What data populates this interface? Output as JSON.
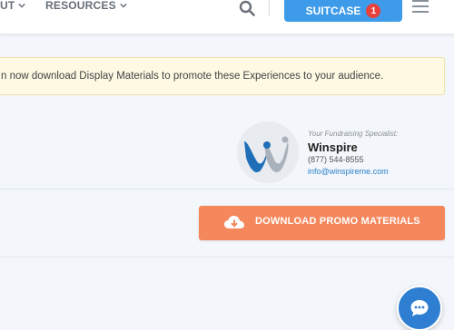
{
  "nav": {
    "items": [
      {
        "label": "UT"
      },
      {
        "label": "RESOURCES"
      }
    ],
    "suitcase_label": "SUITCASE",
    "suitcase_count": "1",
    "icons": {
      "search": "search-icon",
      "menu": "hamburger-menu-icon",
      "chevron": "chevron-down-icon"
    }
  },
  "notice": {
    "text": "n now download Display Materials to promote these Experiences to your audience."
  },
  "specialist": {
    "caption": "Your Fundraising Specialist:",
    "name": "Winspire",
    "phone": "(877) 544-8555",
    "email": "info@winspireme.com"
  },
  "download": {
    "label": "DOWNLOAD PROMO MATERIALS",
    "icon": "cloud-download-icon"
  },
  "chat": {
    "icon": "chat-bubble-icon"
  },
  "colors": {
    "accent_blue": "#3d9be9",
    "badge_red": "#e8413b",
    "download_orange": "#f5875c",
    "notice_bg": "#fdf9e3",
    "page_bg": "#f3f7fb",
    "link_blue": "#2a7fc7",
    "chat_blue": "#2e7fd1"
  }
}
